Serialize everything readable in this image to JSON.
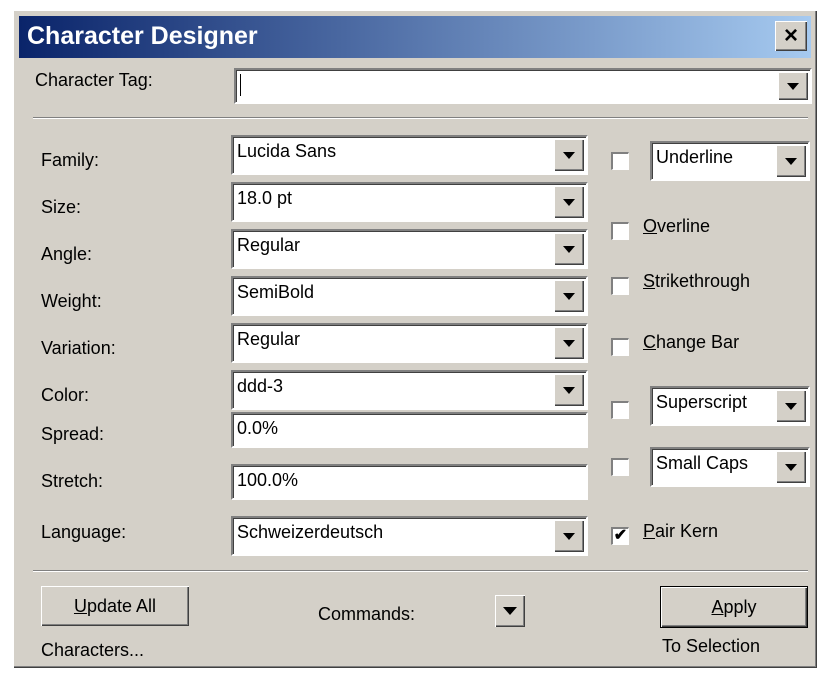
{
  "window": {
    "title": "Character Designer",
    "close_label": "×"
  },
  "tag": {
    "label": "Character Tag:",
    "value": ""
  },
  "fields": {
    "family": {
      "label": "Family:",
      "value": "Lucida Sans"
    },
    "size": {
      "label": "Size:",
      "value": "18.0 pt"
    },
    "angle": {
      "label": "Angle:",
      "value": "Regular"
    },
    "weight": {
      "label": "Weight:",
      "value": "SemiBold"
    },
    "variation": {
      "label": "Variation:",
      "value": "Regular"
    },
    "color": {
      "label": "Color:",
      "value": "ddd-3"
    },
    "spread": {
      "label": "Spread:",
      "value": "0.0%"
    },
    "stretch": {
      "label": "Stretch:",
      "value": "100.0%"
    },
    "language": {
      "label": "Language:",
      "value": "Schweizerdeutsch"
    }
  },
  "options": {
    "underline": {
      "value": "Underline",
      "checked": false
    },
    "overline": {
      "label_u": "O",
      "label_rest": "verline",
      "checked": false
    },
    "strike": {
      "label_u": "S",
      "label_rest": "trikethrough",
      "checked": false
    },
    "changebar": {
      "label_u": "C",
      "label_rest": "hange Bar",
      "checked": false
    },
    "superscript": {
      "value": "Superscript",
      "checked": false
    },
    "smallcaps": {
      "value": "Small Caps",
      "checked": false
    },
    "pairkern": {
      "label_u": "P",
      "label_rest": "air Kern",
      "checked": true,
      "mark": "✔"
    }
  },
  "footer": {
    "update_u": "U",
    "update_rest": "pdate All",
    "characters": "Characters...",
    "commands": "Commands:",
    "apply_u": "A",
    "apply_rest": "pply",
    "to_selection": "To Selection"
  }
}
